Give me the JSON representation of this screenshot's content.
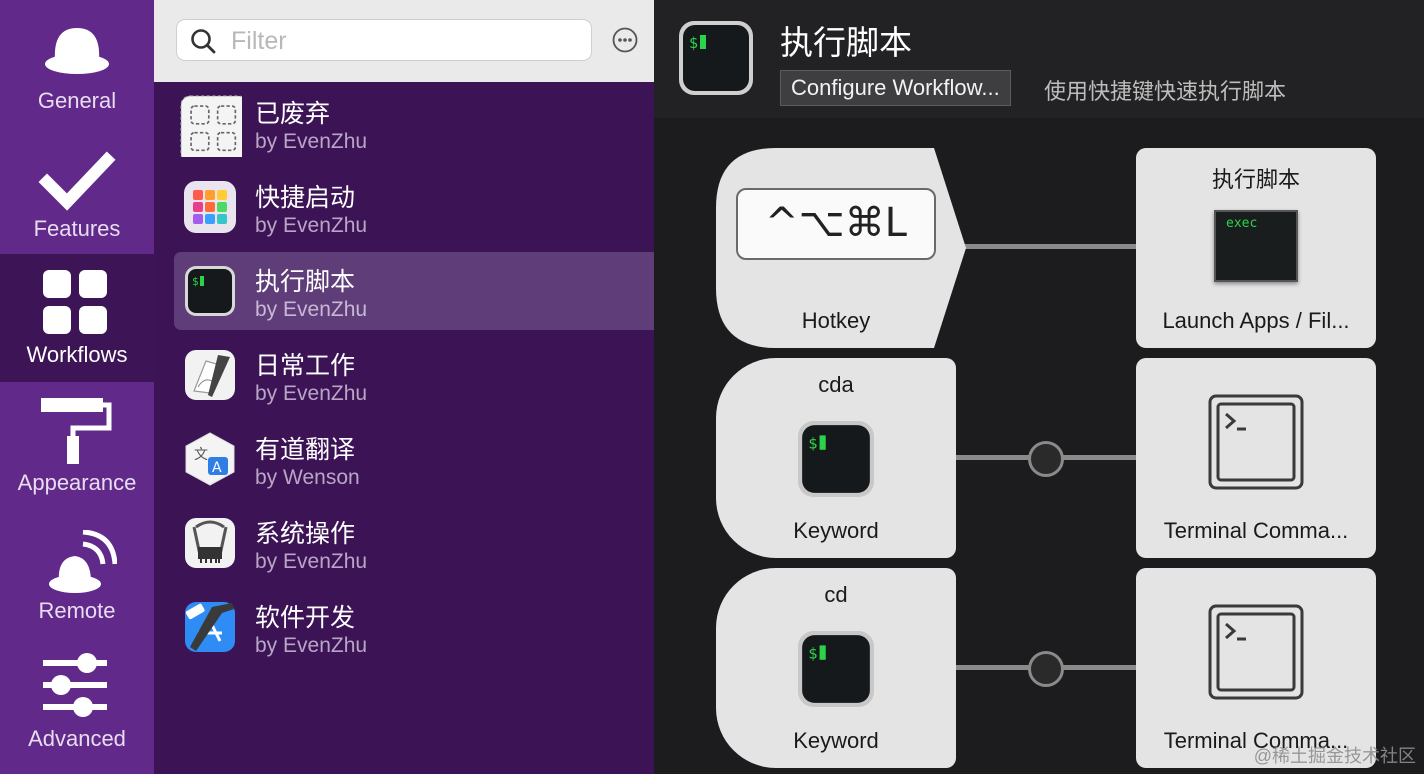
{
  "nav": {
    "items": [
      {
        "label": "General",
        "icon": "hat-icon"
      },
      {
        "label": "Features",
        "icon": "checkmark-icon"
      },
      {
        "label": "Workflows",
        "icon": "grid-icon",
        "active": true
      },
      {
        "label": "Appearance",
        "icon": "paint-roller-icon"
      },
      {
        "label": "Remote",
        "icon": "remote-hat-icon"
      },
      {
        "label": "Advanced",
        "icon": "sliders-icon"
      }
    ]
  },
  "search": {
    "placeholder": "Filter"
  },
  "workflows": [
    {
      "title": "已废弃",
      "author": "by EvenZhu"
    },
    {
      "title": "快捷启动",
      "author": "by EvenZhu"
    },
    {
      "title": "执行脚本",
      "author": "by EvenZhu",
      "selected": true
    },
    {
      "title": "日常工作",
      "author": "by EvenZhu"
    },
    {
      "title": "有道翻译",
      "author": "by Wenson"
    },
    {
      "title": "系统操作",
      "author": "by EvenZhu"
    },
    {
      "title": "软件开发",
      "author": "by EvenZhu"
    }
  ],
  "editor": {
    "title": "执行脚本",
    "configure_label": "Configure Workflow...",
    "description": "使用快捷键快速执行脚本",
    "nodes": {
      "hotkey": {
        "keys": "^⌥⌘L",
        "label": "Hotkey"
      },
      "launch": {
        "title": "执行脚本",
        "icon_text": "exec",
        "label": "Launch Apps / Fil..."
      },
      "keyword1": {
        "title": "cda",
        "label": "Keyword"
      },
      "terminal1": {
        "label": "Terminal Comma..."
      },
      "keyword2": {
        "title": "cd",
        "label": "Keyword"
      },
      "terminal2": {
        "label": "Terminal Comma..."
      }
    }
  },
  "watermark": "@稀土掘金技术社区",
  "colors": {
    "sidebar": "#612a8a",
    "sidebar_active": "#3d1455",
    "list_bg": "#3c1456",
    "selected_row": "#5f3d79",
    "terminal_prompt": "#2bd34a"
  }
}
